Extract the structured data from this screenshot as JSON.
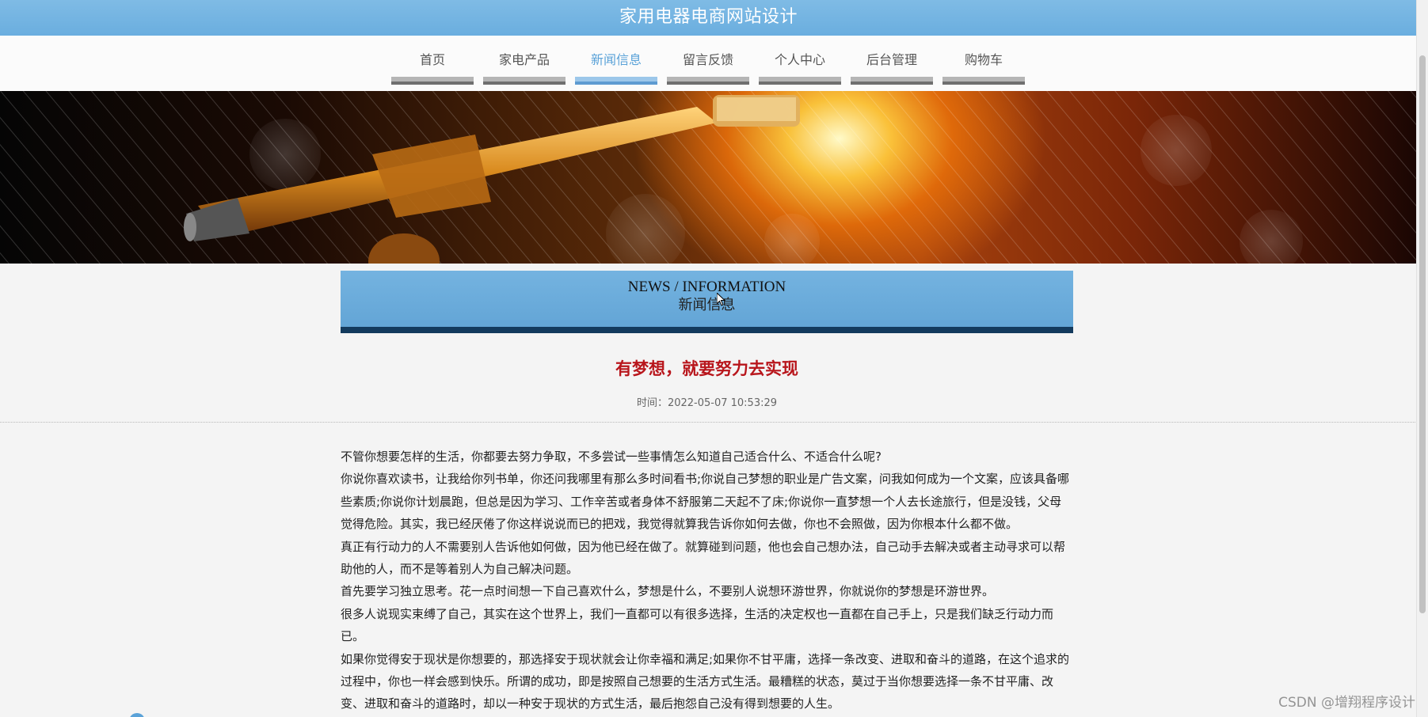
{
  "site": {
    "title": "家用电器电商网站设计"
  },
  "nav": {
    "items": [
      {
        "label": "首页",
        "active": false
      },
      {
        "label": "家电产品",
        "active": false
      },
      {
        "label": "新闻信息",
        "active": true
      },
      {
        "label": "留言反馈",
        "active": false
      },
      {
        "label": "个人中心",
        "active": false
      },
      {
        "label": "后台管理",
        "active": false
      },
      {
        "label": "购物车",
        "active": false
      }
    ],
    "active_color": "#5aa2d8"
  },
  "section": {
    "title_en": "NEWS / INFORMATION",
    "title_cn": "新闻信息"
  },
  "article": {
    "title": "有梦想，就要努力去实现",
    "time": "时间：2022-05-07 10:53:29",
    "title_color": "#b8161c",
    "paragraphs": [
      "不管你想要怎样的生活，你都要去努力争取，不多尝试一些事情怎么知道自己适合什么、不适合什么呢?",
      "你说你喜欢读书，让我给你列书单，你还问我哪里有那么多时间看书;你说自己梦想的职业是广告文案，问我如何成为一个文案，应该具备哪些素质;你说你计划晨跑，但总是因为学习、工作辛苦或者身体不舒服第二天起不了床;你说你一直梦想一个人去长途旅行，但是没钱，父母觉得危险。其实，我已经厌倦了你这样说说而已的把戏，我觉得就算我告诉你如何去做，你也不会照做，因为你根本什么都不做。",
      "真正有行动力的人不需要别人告诉他如何做，因为他已经在做了。就算碰到问题，他也会自己想办法，自己动手去解决或者主动寻求可以帮助他的人，而不是等着别人为自己解决问题。",
      "首先要学习独立思考。花一点时间想一下自己喜欢什么，梦想是什么，不要别人说想环游世界，你就说你的梦想是环游世界。",
      "很多人说现实束缚了自己，其实在这个世界上，我们一直都可以有很多选择，生活的决定权也一直都在自己手上，只是我们缺乏行动力而已。",
      "如果你觉得安于现状是你想要的，那选择安于现状就会让你幸福和满足;如果你不甘平庸，选择一条改变、进取和奋斗的道路，在这个追求的过程中，你也一样会感到快乐。所谓的成功，即是按照自己想要的生活方式生活。最糟糕的状态，莫过于当你想要选择一条不甘平庸、改变、进取和奋斗的道路时，却以一种安于现状的方式生活，最后抱怨自己没有得到想要的人生。"
    ]
  },
  "watermark": "CSDN @增翔程序设计",
  "colors": {
    "header_bg": "#6aaedf",
    "section_border": "#133a5d"
  }
}
